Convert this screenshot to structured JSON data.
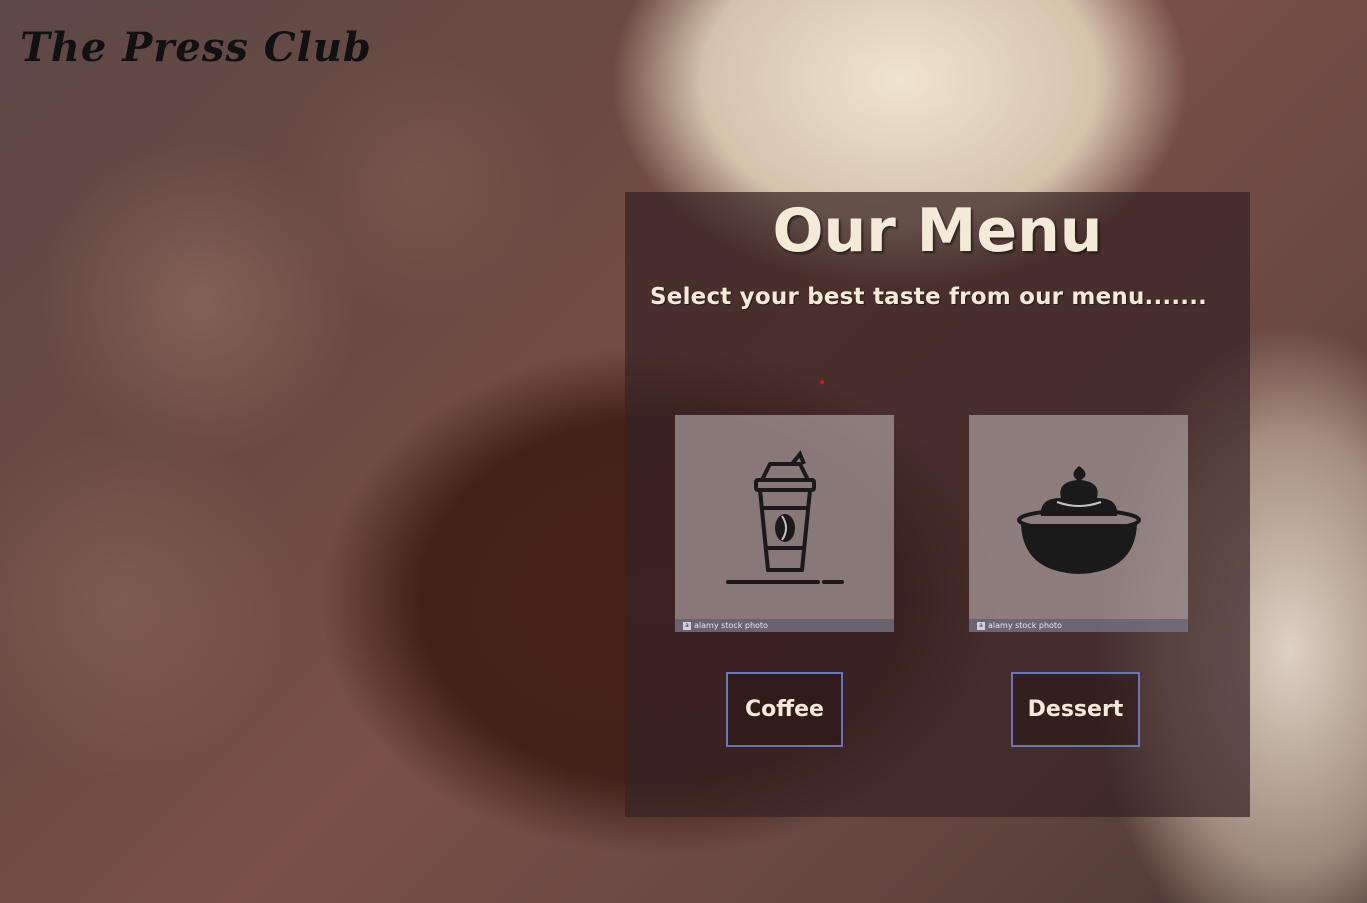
{
  "brand": {
    "name": "The Press Club"
  },
  "menu": {
    "title": "Our Menu",
    "subtitle": "Select your best taste from our menu.......",
    "items": [
      {
        "label": "Coffee",
        "icon": "coffee-cup-icon",
        "watermark": "alamy stock photo"
      },
      {
        "label": "Dessert",
        "icon": "cupcake-icon",
        "watermark": "alamy stock photo"
      }
    ]
  },
  "colors": {
    "title_text": "#f3ead8",
    "panel_bg": "rgba(55,35,35,0.72)",
    "button_border": "#6a74b8",
    "brand_text": "#111111"
  }
}
